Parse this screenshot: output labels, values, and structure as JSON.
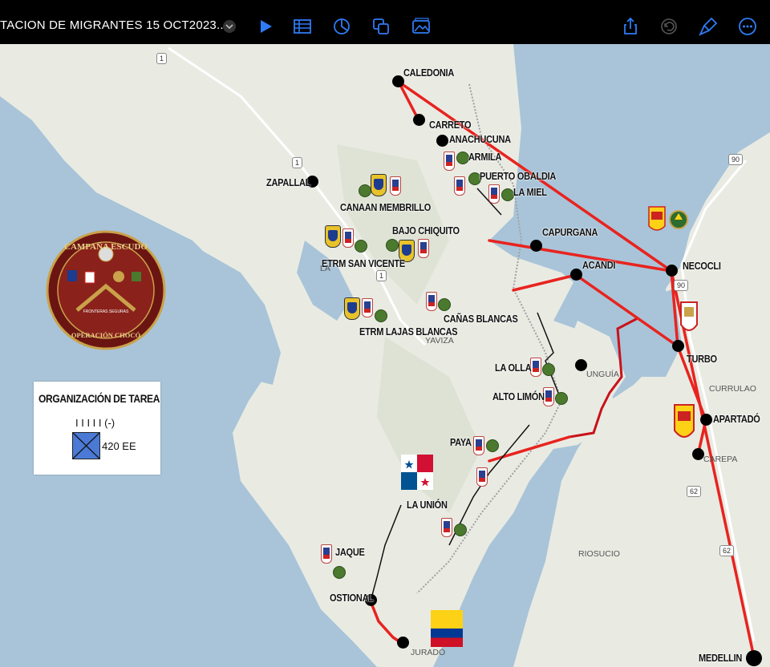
{
  "toolbar": {
    "title": "TACION DE MIGRANTES 15 OCT2023...",
    "icons": [
      "chevron-down-icon",
      "play-icon",
      "table-icon",
      "chart-icon",
      "shapes-icon",
      "media-icon",
      "share-icon",
      "undo-icon",
      "format-brush-icon",
      "more-icon"
    ],
    "accent": "#2f7bf5"
  },
  "campaign_logo": {
    "top_text": "CAMPAÑA ESCUDO",
    "ribbon_text": "FRONTERAS SEGURAS",
    "bottom_text": "OPERACIÓN CHOCÓ"
  },
  "legend": {
    "title": "ORGANIZACIÓN DE TAREA",
    "unit": "I I I I I (-)",
    "strength": "420 EE"
  },
  "locations": {
    "caledonia": "CALEDONIA",
    "carreto": "CARRETO",
    "anachucuna": "ANACHUCUNA",
    "armila": "ARMILA",
    "puerto_obaldia": "PUERTO OBALDIA",
    "la_miel": "LA MIEL",
    "zapallal": "ZAPALLAL",
    "canaan_membrillo": "CANAAN MEMBRILLO",
    "bajo_chiquito": "BAJO CHIQUITO",
    "etrm_san_vicente": "ETRM SAN VICENTE",
    "capurgana": "CAPURGANA",
    "acandi": "ACANDI",
    "necocli": "NECOCLI",
    "canas_blancas": "CAÑAS BLANCAS",
    "etrm_lajas_blancas": "ETRM LAJAS BLANCAS",
    "turbo": "TURBO",
    "la_olla": "LA OLLA",
    "alto_limon": "ALTO LIMÓN",
    "apartado": "APARTADÓ",
    "paya": "PAYA",
    "la_union": "LA UNIÓN",
    "jaque": "JAQUE",
    "ostional": "OSTIONAL",
    "medellin": "MEDELLIN"
  },
  "places": {
    "yaviza": "YAVIZA",
    "unguia": "UNGUÍA",
    "currulao": "CURRULAO",
    "carepa": "CAREPA",
    "riosucio": "RIOSUCIO",
    "jurado": "JURADÓ",
    "la_palma": "LA"
  },
  "road_shields": {
    "r1a": "1",
    "r1b": "1",
    "r1c": "1",
    "r90a": "90",
    "r90b": "90",
    "r62a": "62",
    "r62b": "62"
  },
  "colors": {
    "water": "#a9c4d8",
    "land": "#e9ebe3",
    "route": "#e8231f",
    "border": "#c9121a"
  }
}
